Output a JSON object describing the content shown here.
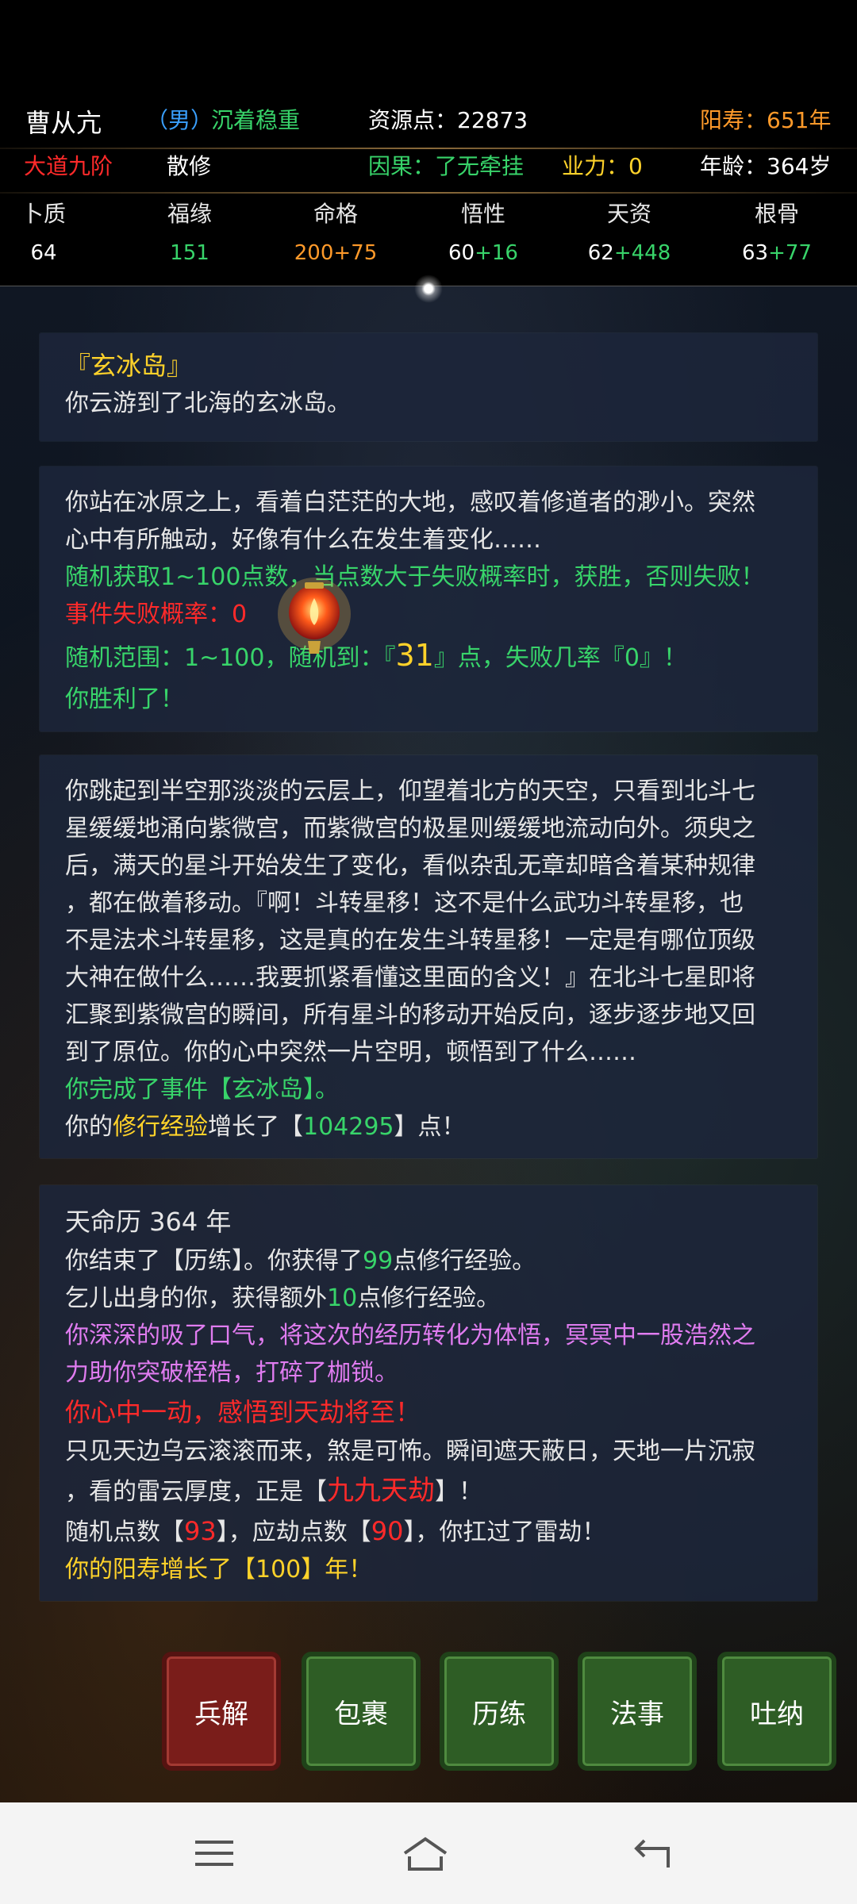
{
  "header": {
    "name": "曹从亢",
    "gender": "（男）",
    "personality": "沉着稳重",
    "resource": "资源点：22873",
    "lifespan": "阳寿：651年",
    "realm": "大道九阶",
    "sect": "散修",
    "karma": "因果：了无牵挂",
    "sin": "业力：0",
    "age": "年龄：364岁"
  },
  "attributes": [
    {
      "name": "卜质",
      "base": "64",
      "bonus": ""
    },
    {
      "name": "福缘",
      "base": "151",
      "bonus": ""
    },
    {
      "name": "命格",
      "base": "200+75",
      "bonus": ""
    },
    {
      "name": "悟性",
      "base": "60",
      "bonus": "+16"
    },
    {
      "name": "天资",
      "base": "62",
      "bonus": "+448"
    },
    {
      "name": "根骨",
      "base": "63",
      "bonus": "+77"
    }
  ],
  "log": {
    "card1": {
      "title": "『玄冰岛』",
      "text": "你云游到了北海的玄冰岛。"
    },
    "card2": {
      "line1": "你站在冰原之上，看着白茫茫的大地，感叹着修道者的渺小。突然",
      "line2": "心中有所触动，好像有什么在发生着变化……",
      "line3": "随机获取1~100点数，当点数大于失败概率时，获胜，否则失败！",
      "line4": "事件失败概率：0",
      "line5a": "随机范围：1~100，随机到：『",
      "line5num": "31",
      "line5b": "』点，失败几率『0』！",
      "line6": "你胜利了！"
    },
    "card3": {
      "l1": "你跳起到半空那淡淡的云层上，仰望着北方的天空，只看到北斗七",
      "l2": "星缓缓地涌向紫微宫，而紫微宫的极星则缓缓地流动向外。须臾之",
      "l3": "后，满天的星斗开始发生了变化，看似杂乱无章却暗含着某种规律",
      "l4": "，都在做着移动。『啊！斗转星移！这不是什么武功斗转星移，也",
      "l5": "不是法术斗转星移，这是真的在发生斗转星移！一定是有哪位顶级",
      "l6": "大神在做什么……我要抓紧看懂这里面的含义！』在北斗七星即将",
      "l7": "汇聚到紫微宫的瞬间，所有星斗的移动开始反向，逐步逐步地又回",
      "l8": "到了原位。你的心中突然一片空明，顿悟到了什么……",
      "l9": "你完成了事件【玄冰岛】。",
      "l10a": "你的",
      "l10b": "修行经验",
      "l10c": "增长了【",
      "l10d": "104295",
      "l10e": "】点！"
    },
    "card4": {
      "title": "天命历  364  年",
      "a1": "你结束了【历练】。你获得了",
      "a2": "99",
      "a3": "点修行经验。",
      "b1": "乞儿出身的你，获得额外",
      "b2": "10",
      "b3": "点修行经验。",
      "c1": "你深深的吸了口气，将这次的经历转化为体悟，冥冥中一股浩然之",
      "c2": "力助你突破桎梏，打碎了枷锁。",
      "d": "你心中一动，感悟到天劫将至！",
      "e1": "只见天边乌云滚滚而来，煞是可怖。瞬间遮天蔽日，天地一片沉寂",
      "e2a": "，看的雷云厚度，正是【",
      "e2b": "九九天劫",
      "e2c": "】！",
      "f1": "随机点数【",
      "f2": "93",
      "f3": "】，应劫点数【",
      "f4": "90",
      "f5": "】，你扛过了雷劫！",
      "g": "你的阳寿增长了【100】年！"
    }
  },
  "actions": [
    "兵解",
    "包裹",
    "历练",
    "法事",
    "吐纳"
  ],
  "navbar": {
    "icons": [
      "menu-icon",
      "home-icon",
      "back-icon"
    ]
  },
  "colors": {
    "green": "#38d46a",
    "red": "#ff2a2a",
    "gold": "#ffd22a",
    "orange": "#ff9a2a",
    "purple": "#e07cf0",
    "card_bg": "#1c263a"
  }
}
